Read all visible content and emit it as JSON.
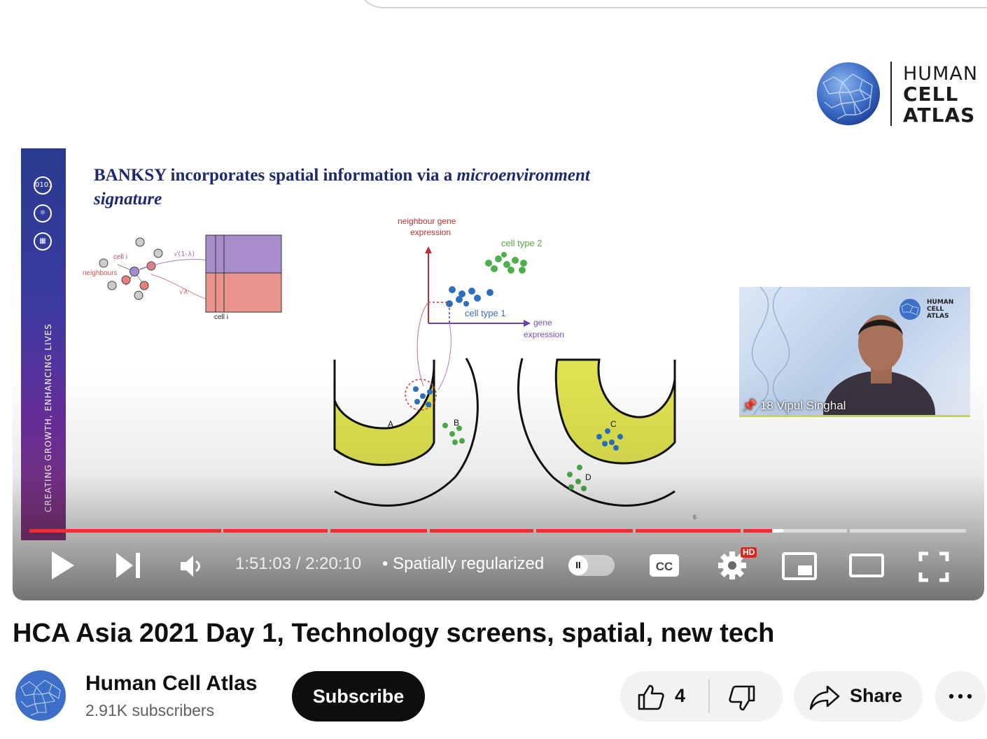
{
  "player": {
    "current_time": "1:51:03",
    "time_separator": " / ",
    "duration": "2:20:10",
    "chapter_dot": "•",
    "chapter": "Spatially regularized",
    "hd_badge": "HD",
    "autoplay_knob": "II",
    "progress_played_fraction": 0.7933,
    "progress_buffered_fraction": 0.805,
    "colors": {
      "progress": "#f03030",
      "hd": "#e62117"
    }
  },
  "brand_logo": {
    "line1": "HUMAN",
    "line2": "CELL",
    "line3": "ATLAS"
  },
  "slide": {
    "title_part1": "BANKSY incorporates spatial information via a ",
    "title_italic1": "microenvironment",
    "title_italic2": "signature",
    "band_text": "CREATING GROWTH, ENHANCING LIVES",
    "band_icons": [
      "binary-icon",
      "atom-icon",
      "circuit-icon"
    ],
    "band_icon_text": "0101",
    "labels": {
      "cell_i": "cell i",
      "neighbours": "neighbours",
      "sqrt_one_minus_lambda": "√(1-λ)",
      "sqrt_lambda": "√λ",
      "matrix_cell_i": "cell i",
      "neighbour_gene_expression_1": "neighbour gene",
      "neighbour_gene_expression_2": "expression",
      "cell_type_2": "cell type 2",
      "cell_type_1": "cell type 1",
      "gene_expression_1": "gene",
      "gene_expression_2": "expression",
      "region_a": "A",
      "region_b": "B",
      "region_c": "C",
      "region_d": "D"
    },
    "page_number": "6"
  },
  "webcam": {
    "name": "18 Vipul Singhal",
    "logo_line1": "HUMAN",
    "logo_line2": "CELL",
    "logo_line3": "ATLAS"
  },
  "video": {
    "title": "HCA Asia 2021 Day 1, Technology screens, spatial, new tech"
  },
  "channel": {
    "name": "Human Cell Atlas",
    "subscribers": "2.91K subscribers",
    "subscribe_label": "Subscribe"
  },
  "actions": {
    "like_count": "4",
    "share_label": "Share"
  }
}
